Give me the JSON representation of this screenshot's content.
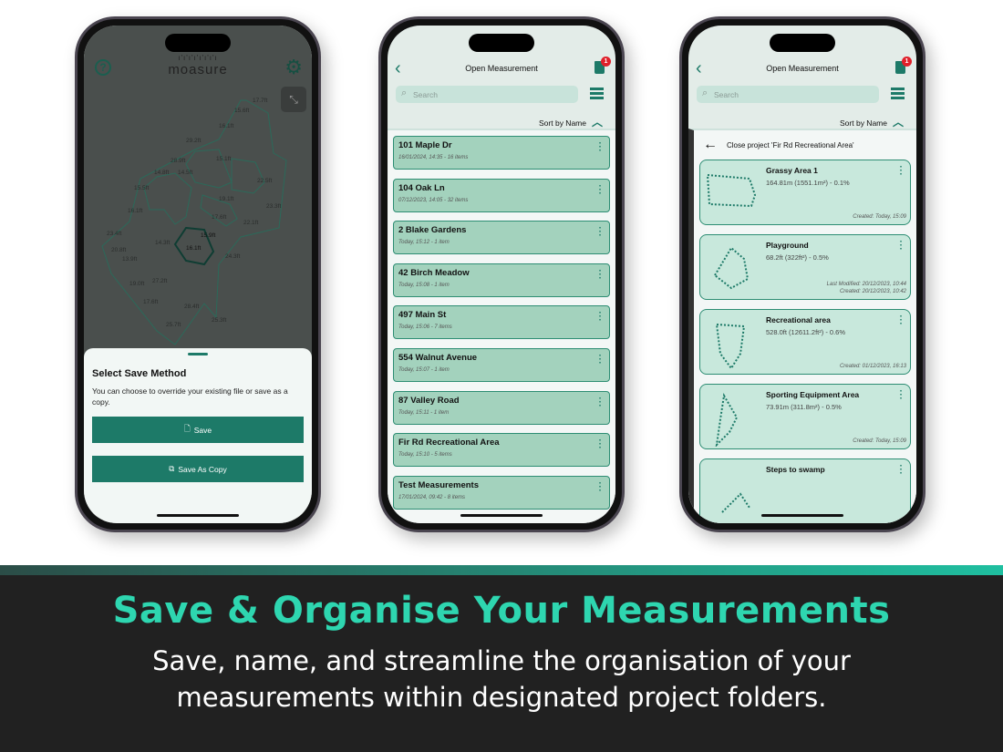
{
  "colors": {
    "accent": "#1d7a68",
    "item_bg": "#a3d2bd",
    "card_bg": "#c8e8dc",
    "banner_title": "#2ed6b0",
    "badge": "#e0202a"
  },
  "phone1": {
    "logo": "moasure",
    "map_labels": [
      "17.7ft",
      "15.6ft",
      "16.1ft",
      "29.2ft",
      "28.9ft",
      "15.1ft",
      "14.8ft",
      "14.5ft",
      "15.5ft",
      "16.1ft",
      "19.1ft",
      "17.6ft",
      "22.5ft",
      "23.3ft",
      "22.1ft",
      "23.4ft",
      "15.9ft",
      "16.1ft",
      "14.3ft",
      "24.3ft",
      "13.9ft",
      "20.8ft",
      "19.0ft",
      "27.2ft",
      "17.6ft",
      "28.4ft",
      "25.7ft",
      "25.3ft"
    ],
    "sheet": {
      "title": "Select Save Method",
      "description": "You can choose to override your existing file or save as a copy.",
      "save": "Save",
      "save_copy": "Save As Copy"
    }
  },
  "phone2": {
    "title": "Open Measurement",
    "badge": "1",
    "search_placeholder": "Search",
    "sort": "Sort by Name",
    "items": [
      {
        "name": "101 Maple Dr",
        "sub": "16/01/2024, 14:35 - 16 items"
      },
      {
        "name": "104 Oak Ln",
        "sub": "07/12/2023, 14:05 - 32 items"
      },
      {
        "name": "2 Blake Gardens",
        "sub": "Today, 15:12 - 1 item"
      },
      {
        "name": "42 Birch Meadow",
        "sub": "Today, 15:08 - 1 item"
      },
      {
        "name": "497 Main St",
        "sub": "Today, 15:06 - 7 items"
      },
      {
        "name": "554 Walnut Avenue",
        "sub": "Today, 15:07 - 1 item"
      },
      {
        "name": "87 Valley Road",
        "sub": "Today, 15:11 - 1 item"
      },
      {
        "name": "Fir Rd Recreational Area",
        "sub": "Today, 15:10 - 5 items"
      },
      {
        "name": "Test Measurements",
        "sub": "17/01/2024, 09:42 - 8 items"
      }
    ]
  },
  "phone3": {
    "title": "Open Measurement",
    "badge": "1",
    "search_placeholder": "Search",
    "sort": "Sort by Name",
    "close_label": "Close project 'Fir Rd Recreational Area'",
    "cards": [
      {
        "name": "Grassy Area 1",
        "metrics": "164.81m (1551.1m²) - 0.1%",
        "dates": "Created: Today, 15:09"
      },
      {
        "name": "Playground",
        "metrics": "68.2ft (322ft²) - 0.5%",
        "dates": "Last Modified: 20/12/2023, 10:44\nCreated: 20/12/2023, 10:42"
      },
      {
        "name": "Recreational area",
        "metrics": "528.0ft (12611.2ft²) - 0.6%",
        "dates": "Created: 01/12/2023, 16:13"
      },
      {
        "name": "Sporting Equipment Area",
        "metrics": "73.91m (311.8m²) - 0.5%",
        "dates": "Created: Today, 15:09"
      },
      {
        "name": "Steps to swamp",
        "metrics": "",
        "dates": ""
      }
    ]
  },
  "banner": {
    "title": "Save & Organise Your Measurements",
    "subtitle_line1": "Save, name, and streamline the organisation of your",
    "subtitle_line2": "measurements within designated project folders."
  }
}
